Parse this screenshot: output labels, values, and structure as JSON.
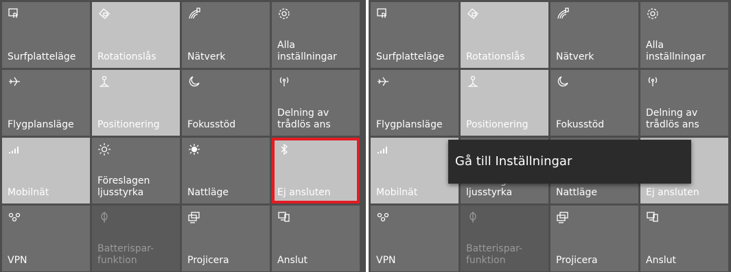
{
  "panels": [
    {
      "tiles": [
        {
          "label": "Surfplatteläge",
          "icon": "tablet-mode-icon",
          "state": "off"
        },
        {
          "label": "Rotationslås",
          "icon": "rotation-lock-icon",
          "state": "on"
        },
        {
          "label": "Nätverk",
          "icon": "network-icon",
          "state": "off"
        },
        {
          "label": "Alla\ninställningar",
          "icon": "gear-icon",
          "state": "off"
        },
        {
          "label": "Flygplansläge",
          "icon": "airplane-icon",
          "state": "off"
        },
        {
          "label": "Positionering",
          "icon": "location-icon",
          "state": "on"
        },
        {
          "label": "Fokusstöd",
          "icon": "moon-icon",
          "state": "off"
        },
        {
          "label": "Delning av\ntrådlös ans",
          "icon": "hotspot-icon",
          "state": "off"
        },
        {
          "label": "Mobilnät",
          "icon": "cellular-icon",
          "state": "on"
        },
        {
          "label": "Föreslagen\nljusstyrka",
          "icon": "brightness-icon",
          "state": "off"
        },
        {
          "label": "Nattläge",
          "icon": "night-light-icon",
          "state": "off"
        },
        {
          "label": "Ej ansluten",
          "icon": "bluetooth-icon",
          "state": "on"
        },
        {
          "label": "VPN",
          "icon": "vpn-icon",
          "state": "off"
        },
        {
          "label": "Batterispar-\nfunktion",
          "icon": "battery-saver-icon",
          "state": "dim"
        },
        {
          "label": "Projicera",
          "icon": "project-icon",
          "state": "off"
        },
        {
          "label": "Anslut",
          "icon": "connect-icon",
          "state": "off"
        }
      ]
    },
    {
      "tiles": [
        {
          "label": "Surfplatteläge",
          "icon": "tablet-mode-icon",
          "state": "off"
        },
        {
          "label": "Rotationslås",
          "icon": "rotation-lock-icon",
          "state": "on"
        },
        {
          "label": "Nätverk",
          "icon": "network-icon",
          "state": "off"
        },
        {
          "label": "Alla\ninställningar",
          "icon": "gear-icon",
          "state": "off"
        },
        {
          "label": "Flygplansläge",
          "icon": "airplane-icon",
          "state": "off"
        },
        {
          "label": "Positionering",
          "icon": "location-icon",
          "state": "on"
        },
        {
          "label": "Fokusstöd",
          "icon": "moon-icon",
          "state": "off"
        },
        {
          "label": "Delning av\ntrådlös ans",
          "icon": "hotspot-icon",
          "state": "off"
        },
        {
          "label": "Mobilnät",
          "icon": "cellular-icon",
          "state": "on"
        },
        {
          "label": "Föreslagen\nljusstyrka",
          "icon": "brightness-icon",
          "state": "off"
        },
        {
          "label": "Nattläge",
          "icon": "night-light-icon",
          "state": "off"
        },
        {
          "label": "Ej ansluten",
          "icon": "bluetooth-icon",
          "state": "on"
        },
        {
          "label": "VPN",
          "icon": "vpn-icon",
          "state": "off"
        },
        {
          "label": "Batterispar-\nfunktion",
          "icon": "battery-saver-icon",
          "state": "dim"
        },
        {
          "label": "Projicera",
          "icon": "project-icon",
          "state": "off"
        },
        {
          "label": "Anslut",
          "icon": "connect-icon",
          "state": "off"
        }
      ]
    }
  ],
  "tooltip": "Gå till Inställningar",
  "colors": {
    "tile_off": "#6d6d6d",
    "tile_on": "#c2c2c2",
    "highlight": "#e31c23",
    "tooltip_bg": "#2b2b2b"
  }
}
